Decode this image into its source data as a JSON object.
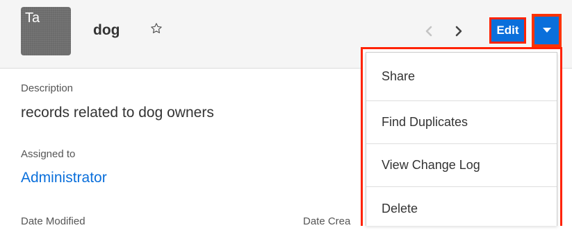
{
  "header": {
    "avatar_text": "Ta",
    "record_name": "dog",
    "edit_label": "Edit"
  },
  "fields": {
    "description": {
      "label": "Description",
      "value": "records related to dog owners"
    },
    "assigned_to": {
      "label": "Assigned to",
      "value": "Administrator"
    },
    "date_modified": {
      "label": "Date Modified"
    },
    "date_created": {
      "label": "Date Crea"
    }
  },
  "actions_menu": {
    "items": [
      {
        "label": "Share"
      },
      {
        "label": "Find Duplicates"
      },
      {
        "label": "View Change Log"
      },
      {
        "label": "Delete"
      }
    ]
  },
  "icons": {
    "favorite": "star-outline-icon",
    "previous": "chevron-left-icon",
    "next": "chevron-right-icon",
    "dropdown": "caret-down-icon"
  },
  "colors": {
    "accent": "#0a6fdb",
    "highlight": "#ff2200",
    "header_bg": "#f5f5f5",
    "avatar_bg": "#6b6b6b"
  }
}
